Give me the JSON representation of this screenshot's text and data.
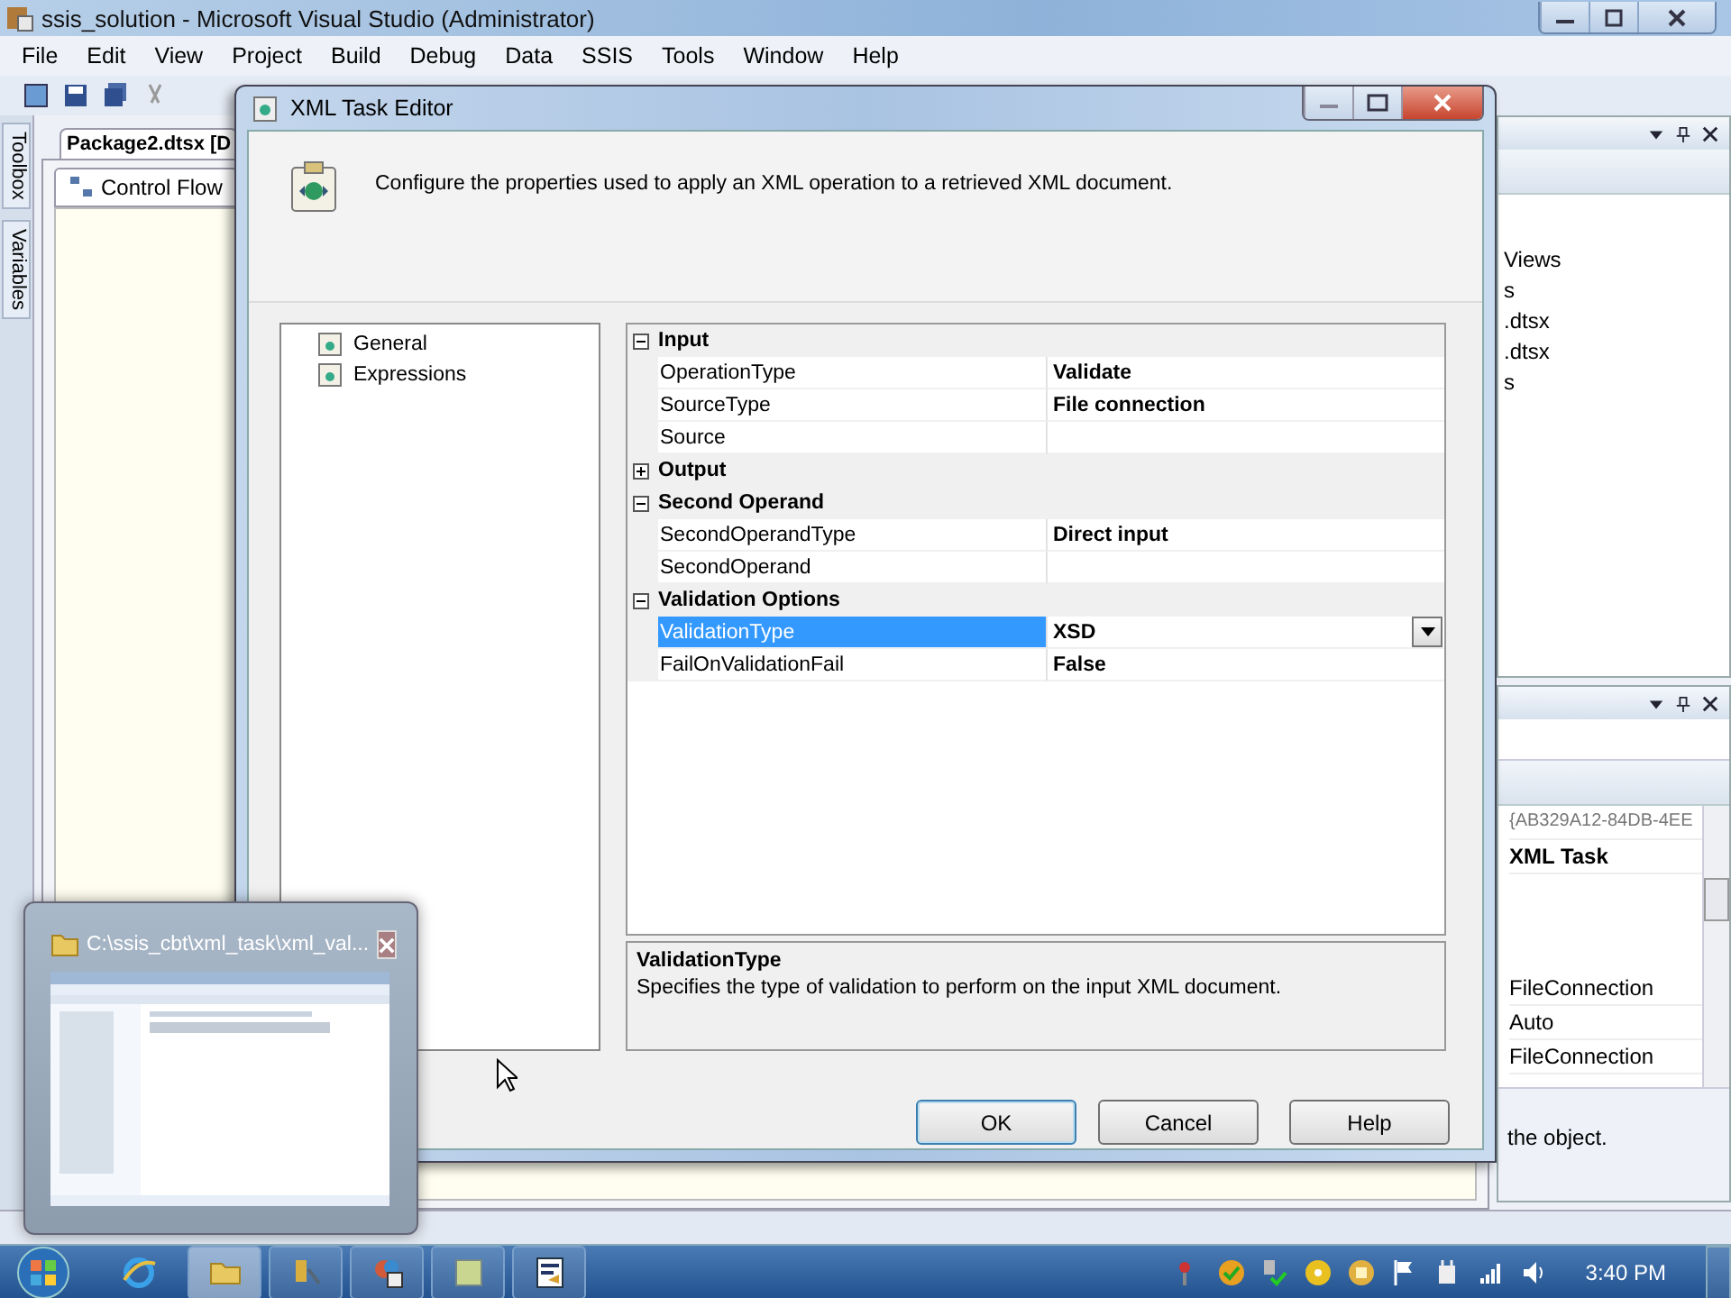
{
  "vs_window": {
    "title": "ssis_solution - Microsoft Visual Studio (Administrator)",
    "menu": [
      "File",
      "Edit",
      "View",
      "Project",
      "Build",
      "Debug",
      "Data",
      "SSIS",
      "Tools",
      "Window",
      "Help"
    ],
    "side_tabs": [
      "Toolbox",
      "Variables"
    ],
    "document_tab": "Package2.dtsx [D",
    "designer_tab": "Control Flow",
    "solution_items": [
      "Views",
      "s",
      ".dtsx",
      ".dtsx",
      "s"
    ],
    "property_values": [
      {
        "value": "{AB329A12-84DB-4EE",
        "kind": "id"
      },
      {
        "value": "XML Task",
        "kind": "bold"
      },
      {
        "value": "FileConnection",
        "kind": "plain"
      },
      {
        "value": "Auto",
        "kind": "plain"
      },
      {
        "value": "FileConnection",
        "kind": "plain"
      }
    ],
    "property_description": "the object."
  },
  "dialog": {
    "title": "XML Task Editor",
    "description": "Configure the properties used to apply an XML operation to a retrieved XML document.",
    "pages": [
      {
        "label": "General",
        "selected": false
      },
      {
        "label": "Expressions",
        "selected": false
      }
    ],
    "categories": [
      {
        "name": "Input",
        "expanded": true,
        "properties": [
          {
            "name": "OperationType",
            "value": "Validate",
            "selected": false
          },
          {
            "name": "SourceType",
            "value": "File connection",
            "selected": false
          },
          {
            "name": "Source",
            "selected": false
          }
        ]
      },
      {
        "name": "Output",
        "expanded": false
      },
      {
        "name": "Second Operand",
        "expanded": true,
        "properties": [
          {
            "name": "SecondOperandType",
            "value": "Direct input",
            "selected": false
          },
          {
            "name": "SecondOperand",
            "selected": false
          }
        ]
      },
      {
        "name": "Validation Options",
        "expanded": true,
        "properties": [
          {
            "name": "ValidationType",
            "value": "XSD",
            "selected": true
          },
          {
            "name": "FailOnValidationFail",
            "value": "False",
            "selected": false
          }
        ]
      }
    ],
    "help": {
      "title": "ValidationType",
      "text": "Specifies the type of validation to perform on the input XML document."
    },
    "buttons": [
      "OK",
      "Cancel",
      "Help"
    ]
  },
  "thumbnail": {
    "title": "C:\\ssis_cbt\\xml_task\\xml_val..."
  },
  "taskbar": {
    "clock": "3:40 PM"
  }
}
